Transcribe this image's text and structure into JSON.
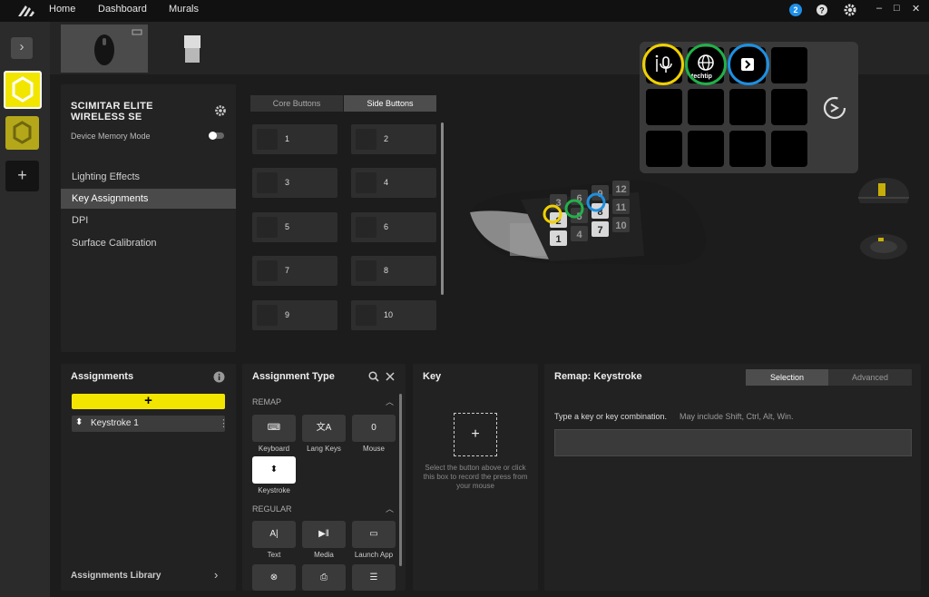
{
  "topbar": {
    "logo": "corsair-sails-logo",
    "nav": [
      "Home",
      "Dashboard",
      "Murals"
    ],
    "notification_count": "2",
    "icons": [
      "help-icon",
      "gear-icon"
    ],
    "window_controls": [
      "–",
      "□",
      "✕"
    ]
  },
  "rail": {
    "expand": "›",
    "add": "+"
  },
  "device": {
    "name": "SCIMITAR ELITE WIRELESS SE",
    "memory_mode_label": "Device Memory Mode"
  },
  "sidebar": {
    "items": [
      {
        "label": "Lighting Effects"
      },
      {
        "label": "Key Assignments"
      },
      {
        "label": "DPI"
      },
      {
        "label": "Surface Calibration"
      }
    ]
  },
  "button_tabs": {
    "core": "Core Buttons",
    "side": "Side Buttons"
  },
  "buttons": [
    "1",
    "2",
    "3",
    "4",
    "5",
    "6",
    "7",
    "8",
    "9",
    "10"
  ],
  "mouse_keys": [
    "1",
    "2",
    "3",
    "4",
    "5",
    "6",
    "7",
    "8",
    "9",
    "10",
    "11",
    "12"
  ],
  "streamdeck": {
    "cell_text": "techtip"
  },
  "assignments": {
    "title": "Assignments",
    "add": "+",
    "items": [
      {
        "label": "Keystroke 1"
      }
    ],
    "library": "Assignments Library",
    "more": "⋮",
    "chevron": "›"
  },
  "assignment_type": {
    "title": "Assignment Type",
    "remap_label": "REMAP",
    "regular_label": "REGULAR",
    "remap_tiles": [
      {
        "label": "Keyboard",
        "glyph": "⌨"
      },
      {
        "label": "Lang Keys",
        "glyph": "文A"
      },
      {
        "label": "Mouse",
        "glyph": "0"
      },
      {
        "label": "Keystroke",
        "glyph": "⬍"
      }
    ],
    "regular_tiles": [
      {
        "label": "Text",
        "glyph": "A|"
      },
      {
        "label": "Media",
        "glyph": "▶‖"
      },
      {
        "label": "Launch App",
        "glyph": "▭"
      },
      {
        "label": "",
        "glyph": "⊗"
      },
      {
        "label": "",
        "glyph": "⎙"
      },
      {
        "label": "",
        "glyph": "☰"
      }
    ]
  },
  "key_panel": {
    "title": "Key",
    "add": "+",
    "hint": "Select the button above or click this box to record the press from your mouse"
  },
  "remap": {
    "title": "Remap: Keystroke",
    "tabs": [
      "Selection",
      "Advanced"
    ],
    "instruction": "Type a key or key combination.",
    "instruction_hint": "May include Shift, Ctrl, Alt, Win.",
    "input_value": ""
  },
  "colors": {
    "accent_yellow": "#f2e600",
    "ring_yellow": "#f0d000",
    "ring_green": "#22b04a",
    "ring_blue": "#1e90e0"
  }
}
